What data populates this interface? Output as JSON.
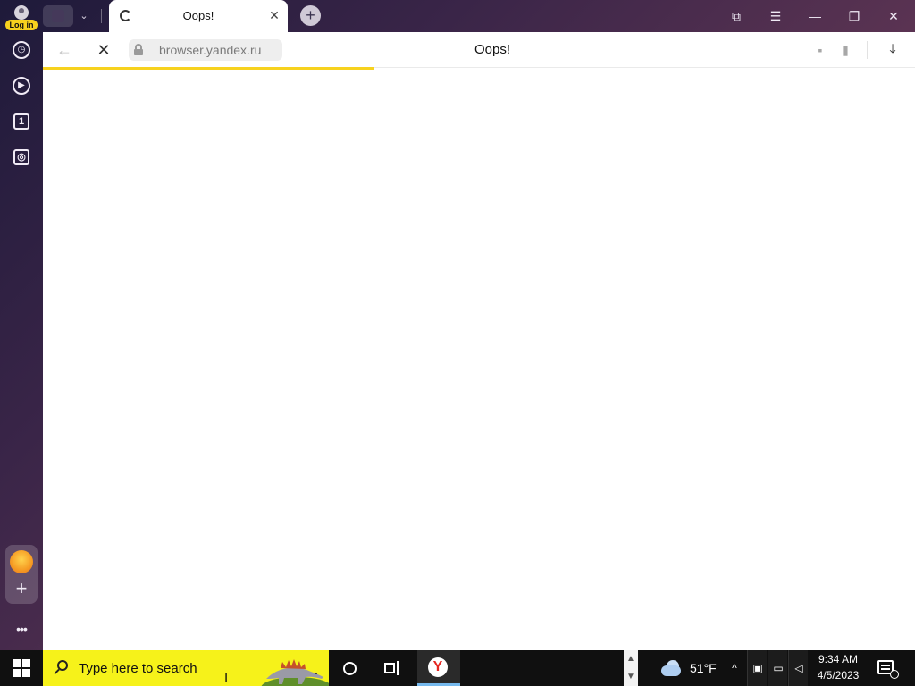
{
  "app": {
    "name": "Yandex Browser",
    "login_label": "Log in",
    "colors": {
      "accent": "#f7d21e",
      "taskbar": "#101010",
      "search_bg": "#f6f21a",
      "yandex_red": "#e52620"
    }
  },
  "tabs": [
    {
      "title": "Oops!",
      "loading": true,
      "active": true
    }
  ],
  "tab_controls": {
    "close_icon": "close-icon",
    "new_tab_icon": "plus-icon",
    "close_glyph": "✕",
    "new_tab_glyph": "+",
    "group_chevron_glyph": "⌄"
  },
  "window_controls": {
    "bookmarks_glyph": "⧉",
    "menu_glyph": "☰",
    "minimize_glyph": "—",
    "restore_glyph": "❐",
    "close_glyph": "✕"
  },
  "sidebar": {
    "items": [
      {
        "name": "history",
        "icon": "clock-icon",
        "glyph": "◷"
      },
      {
        "name": "video",
        "icon": "play-icon",
        "glyph": "▶"
      },
      {
        "name": "tab-count",
        "icon": "tab-count-icon",
        "glyph": "1"
      },
      {
        "name": "screenshot",
        "icon": "camera-icon",
        "glyph": "◎"
      }
    ],
    "add_glyph": "+",
    "more_glyph": "•••"
  },
  "toolbar": {
    "back_glyph": "←",
    "stop_glyph": "✕",
    "url": "browser.yandex.ru",
    "page_title": "Oops!",
    "comment_glyph": "▪",
    "bookmark_glyph": "▮",
    "download_glyph": "⤓",
    "loading_progress": 0.38
  },
  "taskbar": {
    "search_placeholder": "Type here to search",
    "weather": {
      "temp": "51°F",
      "icon": "cloud-icon"
    },
    "tray_chevron": "^",
    "tray_up": "▲",
    "tray_down": "▼",
    "tray_icons": [
      {
        "name": "meet-now",
        "glyph": "▣"
      },
      {
        "name": "network",
        "glyph": "▭"
      },
      {
        "name": "volume-muted",
        "glyph": "◁"
      }
    ],
    "clock": {
      "time": "9:34 AM",
      "date": "4/5/2023"
    },
    "yandex_letter": "Y",
    "cursor_glyph": "I"
  }
}
